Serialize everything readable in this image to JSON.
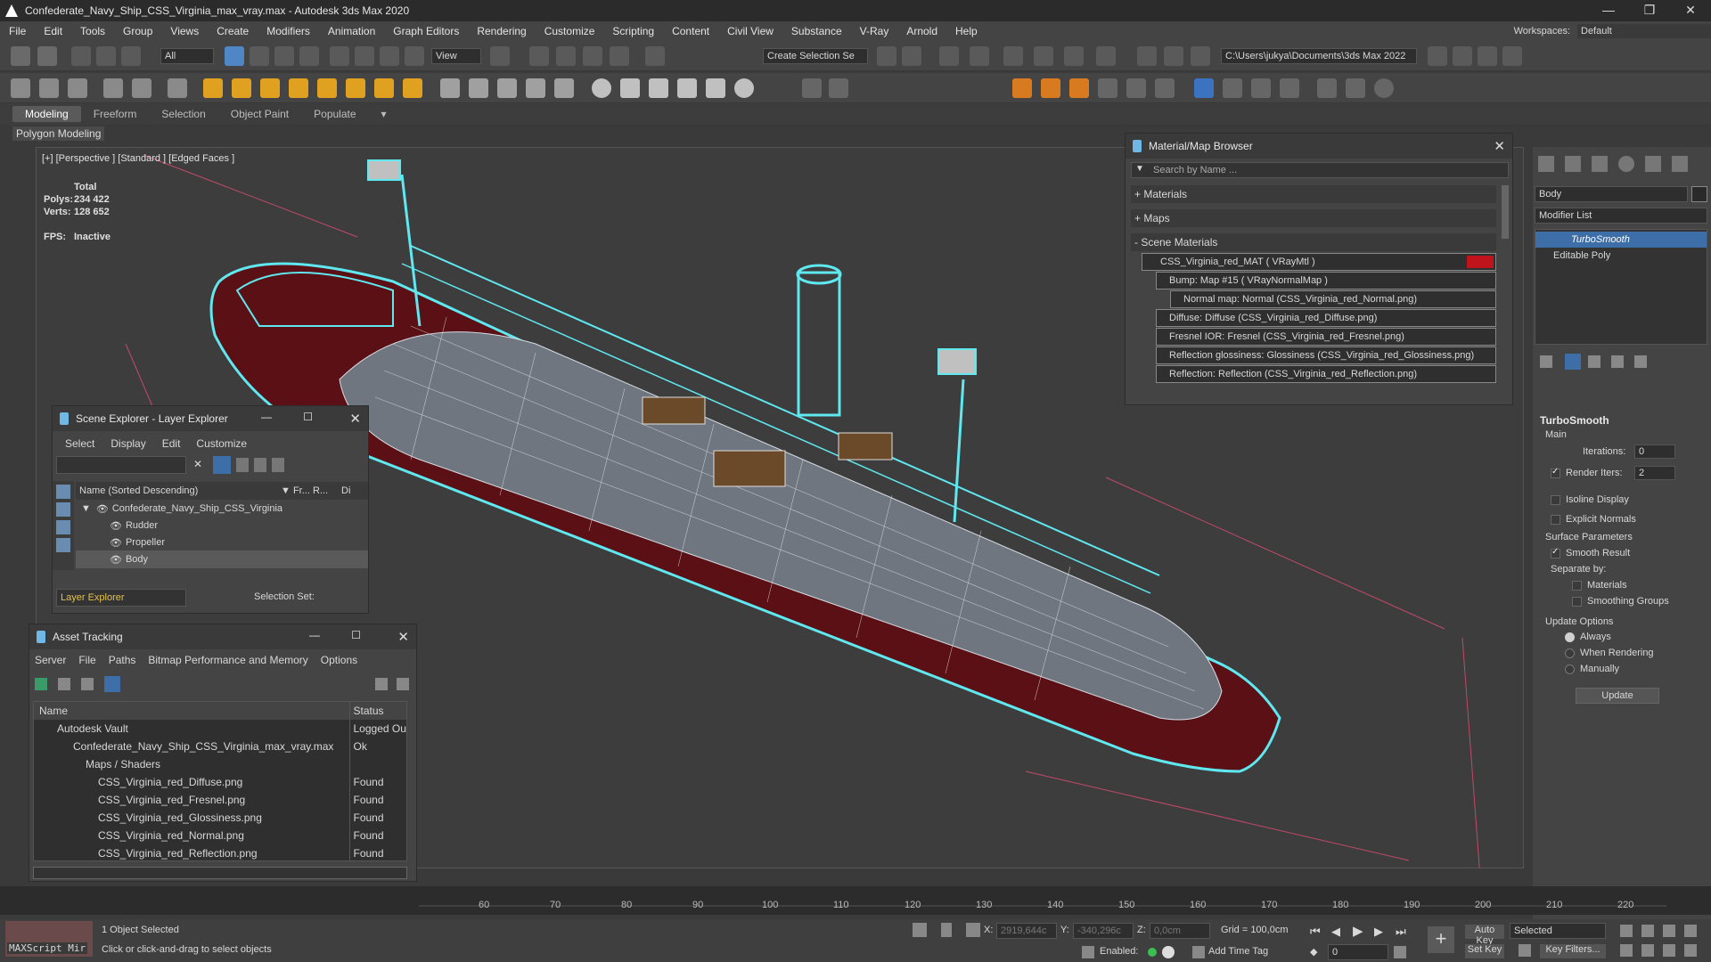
{
  "window": {
    "title": "Confederate_Navy_Ship_CSS_Virginia_max_vray.max - Autodesk 3ds Max 2020",
    "minimize": "—",
    "maximize": "❐",
    "close": "✕"
  },
  "menu": [
    "File",
    "Edit",
    "Tools",
    "Group",
    "Views",
    "Create",
    "Modifiers",
    "Animation",
    "Graph Editors",
    "Rendering",
    "Customize",
    "Scripting",
    "Content",
    "Civil View",
    "Substance",
    "V-Ray",
    "Arnold",
    "Help"
  ],
  "workspace": {
    "label": "Workspaces:",
    "value": "Default"
  },
  "toolbar": {
    "filter_value": "All",
    "view_value": "View",
    "selection_set": "Create Selection Se",
    "path": "C:\\Users\\jukya\\Documents\\3ds Max 2022"
  },
  "ribbon": {
    "tabs": [
      "Modeling",
      "Freeform",
      "Selection",
      "Object Paint",
      "Populate"
    ],
    "sub": "Polygon Modeling"
  },
  "viewport": {
    "label": "[+] [Perspective ] [Standard ] [Edged Faces ]",
    "stats_total": "Total",
    "polys_label": "Polys:",
    "polys_value": "234 422",
    "verts_label": "Verts:",
    "verts_value": "128 652",
    "fps_label": "FPS:",
    "fps_value": "Inactive"
  },
  "material_browser": {
    "title": "Material/Map Browser",
    "search_placeholder": "Search by Name ...",
    "groups": [
      "+ Materials",
      "+ Maps",
      "- Scene Materials"
    ],
    "tree": [
      "CSS_Virginia_red_MAT  ( VRayMtl )",
      "Bump: Map #15  ( VRayNormalMap )",
      "Normal map: Normal (CSS_Virginia_red_Normal.png)",
      "Diffuse: Diffuse (CSS_Virginia_red_Diffuse.png)",
      "Fresnel IOR: Fresnel (CSS_Virginia_red_Fresnel.png)",
      "Reflection glossiness: Glossiness (CSS_Virginia_red_Glossiness.png)",
      "Reflection: Reflection (CSS_Virginia_red_Reflection.png)"
    ]
  },
  "scene_explorer": {
    "title": "Scene Explorer - Layer Explorer",
    "menu": [
      "Select",
      "Display",
      "Edit",
      "Customize"
    ],
    "col_name": "Name (Sorted Descending)",
    "col_fr": "▼ Fr...",
    "col_r": "R...",
    "col_d": "Di",
    "items": [
      "Confederate_Navy_Ship_CSS_Virginia",
      "Rudder",
      "Propeller",
      "Body"
    ],
    "footer_layer": "Layer Explorer",
    "footer_sel": "Selection Set:"
  },
  "asset_tracking": {
    "title": "Asset Tracking",
    "menu": [
      "Server",
      "File",
      "Paths",
      "Bitmap Performance and Memory",
      "Options"
    ],
    "col_name": "Name",
    "col_status": "Status",
    "rows": [
      {
        "name": "Autodesk Vault",
        "status": "Logged Ou"
      },
      {
        "name": "Confederate_Navy_Ship_CSS_Virginia_max_vray.max",
        "status": "Ok"
      },
      {
        "name": "Maps / Shaders",
        "status": ""
      },
      {
        "name": "CSS_Virginia_red_Diffuse.png",
        "status": "Found"
      },
      {
        "name": "CSS_Virginia_red_Fresnel.png",
        "status": "Found"
      },
      {
        "name": "CSS_Virginia_red_Glossiness.png",
        "status": "Found"
      },
      {
        "name": "CSS_Virginia_red_Normal.png",
        "status": "Found"
      },
      {
        "name": "CSS_Virginia_red_Reflection.png",
        "status": "Found"
      }
    ]
  },
  "command_panel": {
    "object_name": "Body",
    "modifier_list": "Modifier List",
    "stack": [
      "TurboSmooth",
      "Editable Poly"
    ],
    "rollout": "TurboSmooth",
    "main": "Main",
    "iterations_label": "Iterations:",
    "iterations_value": "0",
    "render_iters_label": "Render Iters:",
    "render_iters_value": "2",
    "isoline": "Isoline Display",
    "explicit": "Explicit Normals",
    "surface_params": "Surface Parameters",
    "smooth_result": "Smooth Result",
    "separate_by": "Separate by:",
    "materials": "Materials",
    "smoothing_groups": "Smoothing Groups",
    "update_options": "Update Options",
    "always": "Always",
    "when_rendering": "When Rendering",
    "manually": "Manually",
    "update_btn": "Update"
  },
  "timeline": {
    "ticks": [
      "60",
      "70",
      "80",
      "90",
      "100",
      "110",
      "120",
      "130",
      "140",
      "150",
      "160",
      "170",
      "180",
      "190",
      "200",
      "210",
      "220"
    ]
  },
  "status": {
    "maxscript": "MAXScript Mir",
    "selected": "1 Object Selected",
    "hint": "Click or click-and-drag to select objects",
    "x_label": "X:",
    "x_value": "2919,644c",
    "y_label": "Y:",
    "y_value": "-340,296c",
    "z_label": "Z:",
    "z_value": "0,0cm",
    "grid": "Grid = 100,0cm",
    "enabled": "Enabled:",
    "add_time_tag": "Add Time Tag",
    "auto_key": "Auto Key",
    "set_key": "Set Key",
    "selected_dd": "Selected",
    "key_filters": "Key Filters...",
    "frame": "0"
  },
  "colors": {
    "accent_cyan": "#5fe8f0",
    "hull_red": "#5a1014",
    "deck_gray": "#6f7680",
    "selected_blue": "#3d6ea8",
    "mat_red": "#c0141c"
  }
}
